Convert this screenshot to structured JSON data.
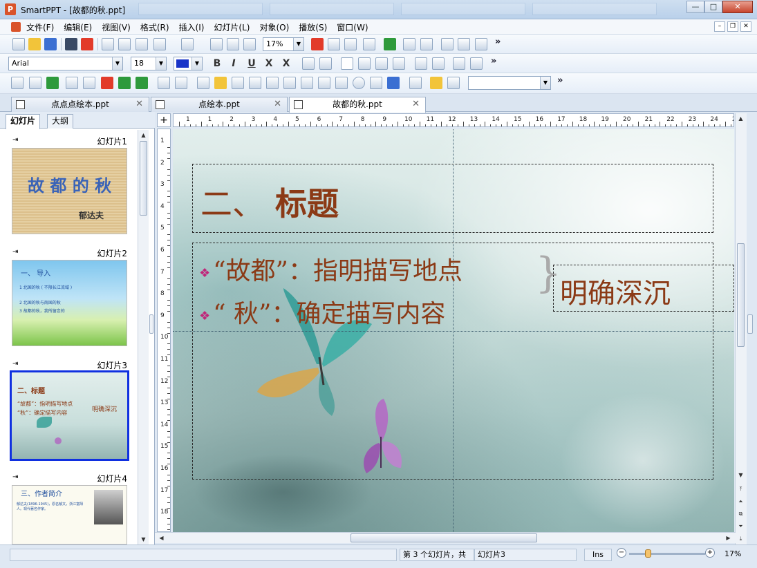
{
  "window": {
    "app_icon": "P",
    "title": "SmartPPT - [故都的秋.ppt]",
    "controls": {
      "minimize": "—",
      "maximize": "□",
      "close": "✕"
    }
  },
  "menubar": {
    "items": [
      "文件(F)",
      "编辑(E)",
      "视图(V)",
      "格式(R)",
      "插入(I)",
      "幻灯片(L)",
      "对象(O)",
      "播放(S)",
      "窗口(W)"
    ],
    "mdi_controls": [
      "–",
      "❐",
      "✕"
    ]
  },
  "toolbar": {
    "zoom_value": "17%",
    "font_name": "Arial",
    "font_size": "18",
    "font_color": "#1a35c8",
    "format_buttons": [
      "B",
      "I",
      "U",
      "X",
      "X"
    ],
    "more": "»",
    "shape_combo_value": ""
  },
  "doc_tabs": [
    {
      "label": "点点点绘本.ppt",
      "close": "✕",
      "active": false
    },
    {
      "label": "点绘本.ppt",
      "close": "✕",
      "active": false
    },
    {
      "label": "故都的秋.ppt",
      "close": "✕",
      "active": true
    }
  ],
  "left_panel": {
    "tabs": [
      "幻灯片",
      "大纲"
    ],
    "slides": [
      {
        "label": "幻灯片1",
        "title": "故 都 的 秋",
        "subtitle": "郁达夫"
      },
      {
        "label": "幻灯片2",
        "title": "一、  导入",
        "lines": [
          "1  北国的秋 ( 不限长江流域 )",
          "2  北国的秋与南国的秋",
          "3  故都的秋，我所留恋的"
        ]
      },
      {
        "label": "幻灯片3",
        "title": "二、标题",
        "lines": [
          "“故都”：指明描写地点",
          "“秋”：确定描写内容"
        ],
        "side": "明确深沉"
      },
      {
        "label": "幻灯片4",
        "title": "三、作者简介",
        "text": "郁达夫(1896-1945)，原名郁文，浙江富阳人。现代著名作家。"
      }
    ]
  },
  "rulers": {
    "corner": "+",
    "h": [
      "1",
      "1",
      "2",
      "3",
      "4",
      "5",
      "6",
      "7",
      "8",
      "9",
      "10",
      "11",
      "12",
      "13",
      "14",
      "15",
      "16",
      "17",
      "18",
      "19",
      "20",
      "21",
      "22",
      "23",
      "24",
      "25"
    ],
    "v": [
      "1",
      "2",
      "3",
      "4",
      "5",
      "6",
      "7",
      "8",
      "9",
      "10",
      "11",
      "12",
      "13",
      "14",
      "15",
      "16",
      "17",
      "18"
    ]
  },
  "slide": {
    "title_prefix": "二、",
    "title": "标题",
    "bullet_glyph": "❖",
    "bullets": [
      "“故都”：指明描写地点",
      "“ 秋”：确定描写内容"
    ],
    "side_text": "明确深沉"
  },
  "status": {
    "slide_position": "第 3 个幻灯片，共",
    "slide_name": "幻灯片3",
    "mode": "Ins",
    "zoom": "17%",
    "zoom_level_fraction": 0.25
  }
}
